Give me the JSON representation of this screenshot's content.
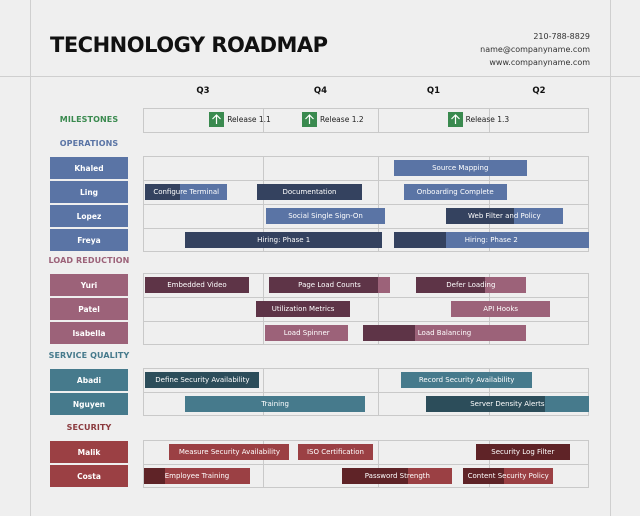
{
  "header": {
    "title": "TECHNOLOGY ROADMAP",
    "phone": "210-788-8829",
    "email": "name@companyname.com",
    "website": "www.companyname.com"
  },
  "chart_data": {
    "type": "gantt",
    "title": "TECHNOLOGY ROADMAP",
    "timeline_units": "quarters (0 = start of Q3, 4 = end of Q2)",
    "quarters": [
      "Q3",
      "Q4",
      "Q1",
      "Q2"
    ],
    "milestones": {
      "label": "MILESTONES",
      "color": "#3a8a4f",
      "items": [
        {
          "label": "Release 1.1",
          "at": 0.61
        },
        {
          "label": "Release 1.2",
          "at": 1.4
        },
        {
          "label": "Release 1.3",
          "at": 2.69
        }
      ]
    },
    "sections": [
      {
        "name": "OPERATIONS",
        "color": "#5a74a5",
        "dark": "#34425f",
        "label_color": "#5a74a5",
        "people": [
          {
            "name": "Khaled",
            "tasks": [
              {
                "label": "Source Mapping",
                "start": 2.14,
                "end": 3.38,
                "progress": 0
              }
            ]
          },
          {
            "name": "Ling",
            "tasks": [
              {
                "label": "Configure Terminal",
                "start": 0.02,
                "end": 0.7,
                "progress": 0.42
              },
              {
                "label": "Documentation",
                "start": 0.95,
                "end": 1.86,
                "progress": 1
              },
              {
                "label": "Onboarding Complete",
                "start": 2.23,
                "end": 3.18,
                "progress": 0
              }
            ]
          },
          {
            "name": "Lopez",
            "tasks": [
              {
                "label": "Social Single Sign-On",
                "start": 1.03,
                "end": 2.06,
                "progress": 0
              },
              {
                "label": "Web Filter and Policy",
                "start": 2.61,
                "end": 3.74,
                "progress": 0.58
              }
            ]
          },
          {
            "name": "Freya",
            "tasks": [
              {
                "label": "Hiring: Phase 1",
                "start": 0.35,
                "end": 2.04,
                "progress": 1
              },
              {
                "label": "Hiring: Phase 2",
                "start": 2.14,
                "end": 4.0,
                "progress": 0.27
              }
            ]
          }
        ]
      },
      {
        "name": "LOAD REDUCTION",
        "color": "#9c6279",
        "dark": "#5e3447",
        "label_color": "#9c6279",
        "people": [
          {
            "name": "Yuri",
            "tasks": [
              {
                "label": "Embedded Video",
                "start": 0.02,
                "end": 0.88,
                "progress": 1
              },
              {
                "label": "Page Load Counts",
                "start": 1.05,
                "end": 2.11,
                "progress": 0.9
              },
              {
                "label": "Defer Loading",
                "start": 2.34,
                "end": 3.37,
                "progress": 0.63
              }
            ]
          },
          {
            "name": "Patel",
            "tasks": [
              {
                "label": "Utilization Metrics",
                "start": 0.94,
                "end": 1.76,
                "progress": 1
              },
              {
                "label": "API Hooks",
                "start": 2.66,
                "end": 3.61,
                "progress": 0
              }
            ]
          },
          {
            "name": "Isabella",
            "tasks": [
              {
                "label": "Load Spinner",
                "start": 1.02,
                "end": 1.74,
                "progress": 0
              },
              {
                "label": "Load Balancing",
                "start": 1.87,
                "end": 3.37,
                "progress": 0.32
              }
            ]
          }
        ]
      },
      {
        "name": "SERVICE QUALITY",
        "color": "#467a8c",
        "dark": "#2c4d5a",
        "label_color": "#467a8c",
        "people": [
          {
            "name": "Abadi",
            "tasks": [
              {
                "label": "Define Security Availability",
                "start": 0.02,
                "end": 0.97,
                "progress": 1
              },
              {
                "label": "Record Security Availability",
                "start": 2.21,
                "end": 3.43,
                "progress": 0
              }
            ]
          },
          {
            "name": "Nguyen",
            "tasks": [
              {
                "label": "Training",
                "start": 0.35,
                "end": 1.89,
                "progress": 0
              },
              {
                "label": "Server Density Alerts",
                "start": 2.43,
                "end": 4.0,
                "progress": 0.73
              }
            ]
          }
        ]
      },
      {
        "name": "SECURITY",
        "color": "#9b4044",
        "dark": "#5f2327",
        "label_color": "#8b3a3e",
        "people": [
          {
            "name": "Malik",
            "tasks": [
              {
                "label": "Measure Security Availability",
                "start": 0.22,
                "end": 1.23,
                "progress": 0
              },
              {
                "label": "ISO Certification",
                "start": 1.3,
                "end": 1.96,
                "progress": 0
              },
              {
                "label": "Security Log Filter",
                "start": 2.88,
                "end": 3.81,
                "progress": 1
              }
            ]
          },
          {
            "name": "Costa",
            "tasks": [
              {
                "label": "Employee Training",
                "start": 0.01,
                "end": 0.89,
                "progress": 0.2
              },
              {
                "label": "Password Strength",
                "start": 1.69,
                "end": 2.67,
                "progress": 0.6
              },
              {
                "label": "Content Security Policy",
                "start": 2.77,
                "end": 3.64,
                "progress": 0.45
              }
            ]
          }
        ]
      }
    ]
  }
}
